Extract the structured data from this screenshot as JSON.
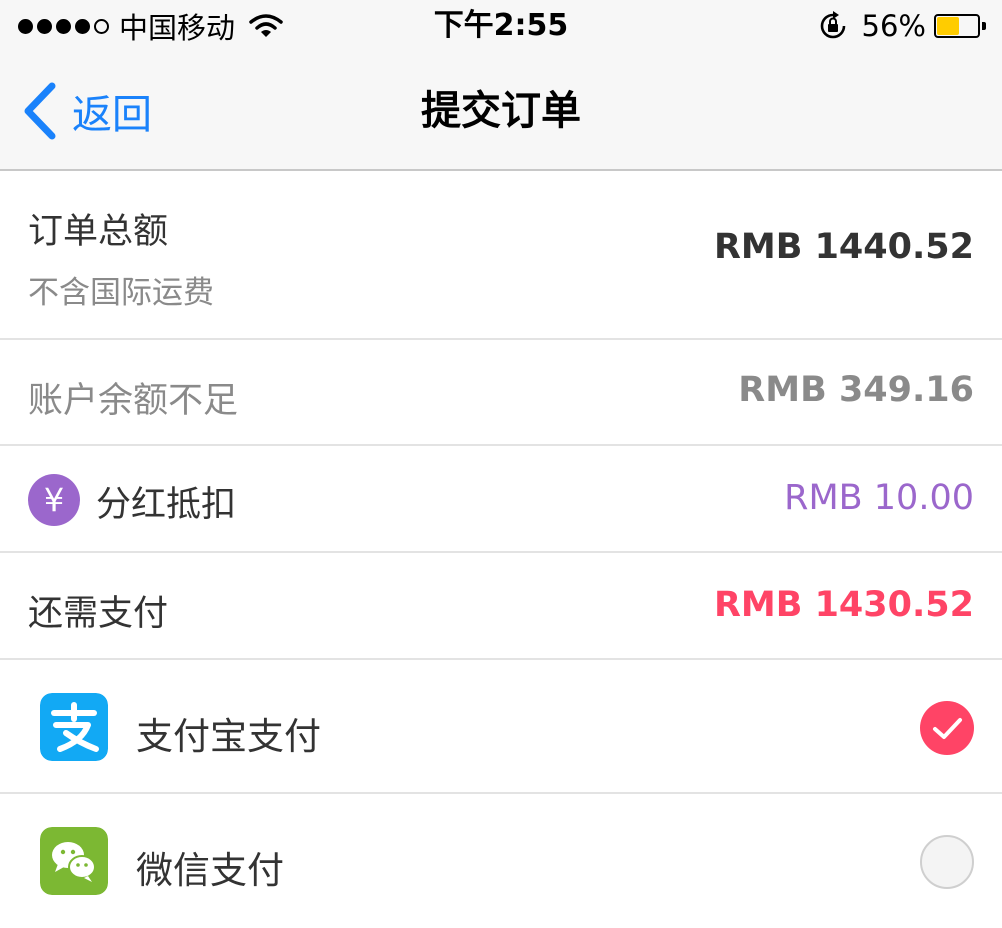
{
  "status_bar": {
    "carrier": "中国移动",
    "time": "下午2:55",
    "battery_percent": "56%",
    "battery_level": 0.56,
    "battery_color": "#ffcc00",
    "signal_bars_filled": 4,
    "icons": [
      "signal-dots-icon",
      "wifi-icon",
      "rotation-lock-icon",
      "battery-icon"
    ]
  },
  "nav": {
    "back_label": "返回",
    "title": "提交订单",
    "accent": "#1a82fb"
  },
  "order_total": {
    "label": "订单总额",
    "sublabel": "不含国际运费",
    "amount": "RMB 1440.52",
    "color": "#333333"
  },
  "balance": {
    "label": "账户余额不足",
    "amount": "RMB 349.16",
    "color": "#8a8a8a"
  },
  "dividend": {
    "icon": "yen-icon",
    "icon_glyph": "¥",
    "label": "分红抵扣",
    "amount": "RMB 10.00",
    "color": "#9b67cc"
  },
  "amount_due": {
    "label": "还需支付",
    "amount": "RMB 1430.52",
    "color": "#ff4466"
  },
  "payment_methods": [
    {
      "icon": "alipay-icon",
      "label": "支付宝支付",
      "selected": true,
      "color": "#12a9f4"
    },
    {
      "icon": "wechat-icon",
      "label": "微信支付",
      "selected": false,
      "color": "#7cb833"
    }
  ],
  "selected_color": "#ff4466"
}
